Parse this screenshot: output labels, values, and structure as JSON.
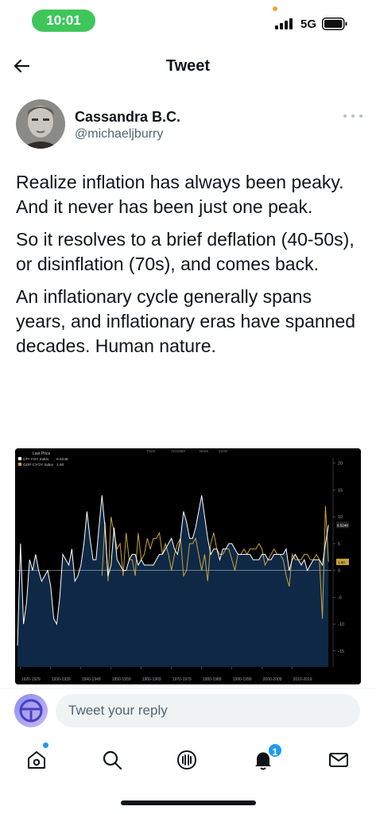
{
  "status_bar": {
    "time": "10:01",
    "network": "5G",
    "icons": [
      "signal-icon",
      "battery-icon"
    ]
  },
  "header": {
    "title": "Tweet",
    "back_icon": "back-arrow-icon"
  },
  "tweet": {
    "author_name": "Cassandra B.C.",
    "author_handle": "@michaeljburry",
    "paragraphs": [
      "Realize inflation has always been peaky. And it never has been just one peak.",
      "So it resolves to a brief deflation (40-50s), or disinflation (70s), and comes back.",
      "An inflationary cycle generally spans years, and inflationary eras have spanned decades. Human nature."
    ]
  },
  "chart_data": {
    "type": "area",
    "legend_title": "Last Price",
    "toolbar": [
      "Track",
      "Annotate",
      "News",
      "Zoom"
    ],
    "series": [
      {
        "name": "CPI YOY Index",
        "last_value_label": "8.5248",
        "color": "#ffffff"
      },
      {
        "name": "GDP CYOY Index",
        "last_value_label": "1.60",
        "color": "#c8a43a"
      }
    ],
    "x_tick_labels": [
      "1920-1929",
      "1930-1939",
      "1940-1949",
      "1950-1959",
      "1960-1969",
      "1970-1979",
      "1980-1989",
      "1990-1999",
      "2000-2009",
      "2010-2019"
    ],
    "y_tick_labels": [
      "20",
      "15",
      "10",
      "5",
      "0",
      "-5",
      "-10",
      "-15"
    ],
    "ylim": [
      -18,
      21
    ],
    "x_range": [
      1919,
      2023
    ],
    "cpi_points": [
      [
        1919,
        -14
      ],
      [
        1920,
        5
      ],
      [
        1921,
        -10
      ],
      [
        1922,
        -6
      ],
      [
        1923,
        2
      ],
      [
        1924,
        0
      ],
      [
        1925,
        3
      ],
      [
        1926,
        0
      ],
      [
        1927,
        -2
      ],
      [
        1928,
        -1
      ],
      [
        1929,
        0
      ],
      [
        1930,
        -3
      ],
      [
        1931,
        -9
      ],
      [
        1932,
        -10
      ],
      [
        1933,
        -5
      ],
      [
        1934,
        3
      ],
      [
        1935,
        2
      ],
      [
        1936,
        1
      ],
      [
        1937,
        4
      ],
      [
        1938,
        -2
      ],
      [
        1939,
        -1
      ],
      [
        1940,
        1
      ],
      [
        1941,
        5
      ],
      [
        1942,
        11
      ],
      [
        1943,
        6
      ],
      [
        1944,
        2
      ],
      [
        1945,
        2
      ],
      [
        1946,
        8
      ],
      [
        1947,
        14
      ],
      [
        1948,
        8
      ],
      [
        1949,
        -1
      ],
      [
        1950,
        1
      ],
      [
        1951,
        8
      ],
      [
        1952,
        2
      ],
      [
        1953,
        1
      ],
      [
        1954,
        0
      ],
      [
        1955,
        0
      ],
      [
        1956,
        2
      ],
      [
        1957,
        3
      ],
      [
        1958,
        3
      ],
      [
        1959,
        1
      ],
      [
        1960,
        2
      ],
      [
        1961,
        1
      ],
      [
        1962,
        1
      ],
      [
        1963,
        1
      ],
      [
        1964,
        1
      ],
      [
        1965,
        2
      ],
      [
        1966,
        3
      ],
      [
        1967,
        3
      ],
      [
        1968,
        4
      ],
      [
        1969,
        5
      ],
      [
        1970,
        6
      ],
      [
        1971,
        4
      ],
      [
        1972,
        3
      ],
      [
        1973,
        6
      ],
      [
        1974,
        11
      ],
      [
        1975,
        9
      ],
      [
        1976,
        6
      ],
      [
        1977,
        6
      ],
      [
        1978,
        8
      ],
      [
        1979,
        11
      ],
      [
        1980,
        14
      ],
      [
        1981,
        10
      ],
      [
        1982,
        6
      ],
      [
        1983,
        3
      ],
      [
        1984,
        4
      ],
      [
        1985,
        4
      ],
      [
        1986,
        2
      ],
      [
        1987,
        4
      ],
      [
        1988,
        4
      ],
      [
        1989,
        5
      ],
      [
        1990,
        5
      ],
      [
        1991,
        4
      ],
      [
        1992,
        3
      ],
      [
        1993,
        3
      ],
      [
        1994,
        3
      ],
      [
        1995,
        3
      ],
      [
        1996,
        3
      ],
      [
        1997,
        2
      ],
      [
        1998,
        2
      ],
      [
        1999,
        2
      ],
      [
        2000,
        3
      ],
      [
        2001,
        3
      ],
      [
        2002,
        2
      ],
      [
        2003,
        2
      ],
      [
        2004,
        3
      ],
      [
        2005,
        3
      ],
      [
        2006,
        3
      ],
      [
        2007,
        3
      ],
      [
        2008,
        4
      ],
      [
        2009,
        0
      ],
      [
        2010,
        2
      ],
      [
        2011,
        3
      ],
      [
        2012,
        2
      ],
      [
        2013,
        1
      ],
      [
        2014,
        2
      ],
      [
        2015,
        0
      ],
      [
        2016,
        1
      ],
      [
        2017,
        2
      ],
      [
        2018,
        2
      ],
      [
        2019,
        2
      ],
      [
        2020,
        1
      ],
      [
        2021,
        5
      ],
      [
        2022,
        8.5
      ]
    ],
    "gdp_points": [
      [
        1947,
        -1
      ],
      [
        1948,
        9
      ],
      [
        1949,
        -2
      ],
      [
        1950,
        10
      ],
      [
        1951,
        7
      ],
      [
        1952,
        4
      ],
      [
        1953,
        5
      ],
      [
        1954,
        -1
      ],
      [
        1955,
        7
      ],
      [
        1956,
        2
      ],
      [
        1957,
        2
      ],
      [
        1958,
        -1
      ],
      [
        1959,
        7
      ],
      [
        1960,
        2
      ],
      [
        1961,
        3
      ],
      [
        1962,
        6
      ],
      [
        1963,
        4
      ],
      [
        1964,
        6
      ],
      [
        1965,
        6
      ],
      [
        1966,
        7
      ],
      [
        1967,
        3
      ],
      [
        1968,
        5
      ],
      [
        1969,
        3
      ],
      [
        1970,
        0
      ],
      [
        1971,
        3
      ],
      [
        1972,
        5
      ],
      [
        1973,
        6
      ],
      [
        1974,
        -1
      ],
      [
        1975,
        0
      ],
      [
        1976,
        5
      ],
      [
        1977,
        5
      ],
      [
        1978,
        6
      ],
      [
        1979,
        3
      ],
      [
        1980,
        0
      ],
      [
        1981,
        3
      ],
      [
        1982,
        -2
      ],
      [
        1983,
        5
      ],
      [
        1984,
        7
      ],
      [
        1985,
        4
      ],
      [
        1986,
        3
      ],
      [
        1987,
        3
      ],
      [
        1988,
        4
      ],
      [
        1989,
        4
      ],
      [
        1990,
        2
      ],
      [
        1991,
        0
      ],
      [
        1992,
        3
      ],
      [
        1993,
        3
      ],
      [
        1994,
        4
      ],
      [
        1995,
        3
      ],
      [
        1996,
        4
      ],
      [
        1997,
        4
      ],
      [
        1998,
        4
      ],
      [
        1999,
        5
      ],
      [
        2000,
        4
      ],
      [
        2001,
        1
      ],
      [
        2002,
        2
      ],
      [
        2003,
        3
      ],
      [
        2004,
        4
      ],
      [
        2005,
        3
      ],
      [
        2006,
        3
      ],
      [
        2007,
        2
      ],
      [
        2008,
        -1
      ],
      [
        2009,
        -3
      ],
      [
        2010,
        3
      ],
      [
        2011,
        2
      ],
      [
        2012,
        2
      ],
      [
        2013,
        2
      ],
      [
        2014,
        3
      ],
      [
        2015,
        3
      ],
      [
        2016,
        2
      ],
      [
        2017,
        2
      ],
      [
        2018,
        3
      ],
      [
        2019,
        2
      ],
      [
        2020,
        -9
      ],
      [
        2021,
        12
      ],
      [
        2022,
        1.6
      ]
    ]
  },
  "reply": {
    "placeholder": "Tweet your reply"
  },
  "tab_bar": {
    "items": [
      "home-icon",
      "search-icon",
      "spaces-icon",
      "notifications-icon",
      "messages-icon"
    ],
    "notification_count": "1"
  },
  "colors": {
    "accent": "#1d9bf0",
    "chart_fill": "#0f2a4a",
    "cpi_line": "#ffffff",
    "gdp_line": "#c8a43a"
  }
}
